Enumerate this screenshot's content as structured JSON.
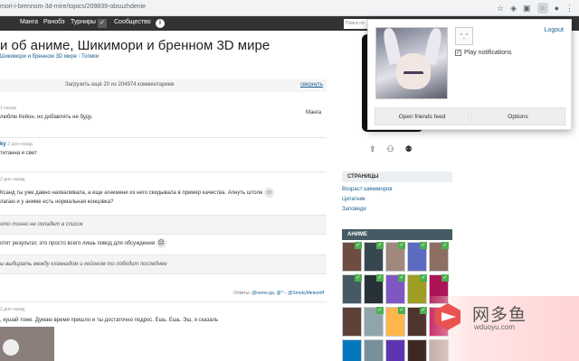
{
  "browser": {
    "url": "mori-i-brennom-3d-mire/topics/209839-obsuzhdenie",
    "icons": [
      "star-icon",
      "shield-icon",
      "extension-icon",
      "extension-active-icon",
      "profile-icon",
      "menu-icon"
    ]
  },
  "nav": {
    "items": [
      "Манга",
      "Ранобэ",
      "Турниры",
      "Сообщество"
    ],
    "search_placeholder": "Поиск по"
  },
  "page": {
    "title": "и об аниме, Шикимори и бренном 3D мире",
    "breadcrumbs": [
      "Шикимори и бренном 3D мире",
      "Топики"
    ]
  },
  "comments": {
    "load_more": "Загрузить ещё 20 из 204974 комментариев",
    "collapse": "свернуть",
    "items": [
      {
        "meta": "1 назад",
        "text": "люблю Кейон, но добавлять не буду."
      },
      {
        "nick": "ky",
        "meta": "2 дня назад",
        "text": "титанна и свет"
      },
      {
        "meta": "2 дня назад",
        "text": "Ксанд ты уже давно нахваливала, а еще агнемени из него скидывала в пример качества. Апнуть штоле",
        "text2": "лагаю и у аниме есть нормальная концовка?"
      },
      {
        "quote": "ото тонно не попадет в список"
      },
      {
        "text": "отит результат, это просто всего лишь повод для обсуждения"
      },
      {
        "quote": "ы выбирать между кланнадом и кейоном то победит последнее"
      },
      {
        "replies_label": "Ответы:",
        "replies": [
          "@nemo.ga",
          "@*~",
          "@SmokyMeteoriff"
        ]
      },
      {
        "meta": "2 дня назад",
        "text": ", кушай тоже. Думаю время пришло и ты достаточно подрос. Ешь. Ешь. Эш, я сказаль"
      }
    ],
    "manga_tag": "Манга"
  },
  "sidebar": {
    "pages_header": "СТРАНИЦЫ",
    "links": [
      "Возраст шикиморов",
      "Цитатник",
      "Заповеди"
    ],
    "anime_header": "АНИМЕ",
    "anime_tiles": [
      {
        "color": "#6d4c41",
        "checked": true
      },
      {
        "color": "#37474f",
        "checked": true
      },
      {
        "color": "#a1887f",
        "checked": true
      },
      {
        "color": "#5c6bc0",
        "checked": true
      },
      {
        "color": "#8d6e63",
        "checked": true
      },
      {
        "color": "#455a64",
        "checked": true
      },
      {
        "color": "#263238",
        "checked": true
      },
      {
        "color": "#7e57c2",
        "checked": true
      },
      {
        "color": "#9e9d24",
        "checked": true
      },
      {
        "color": "#ad1457",
        "checked": true
      },
      {
        "color": "#5d4037",
        "checked": false
      },
      {
        "color": "#90a4ae",
        "checked": true
      },
      {
        "color": "#ffb74d",
        "checked": true
      },
      {
        "color": "#4e342e",
        "checked": true
      },
      {
        "color": "#c2185b",
        "checked": true
      },
      {
        "color": "#0277bd",
        "checked": false
      },
      {
        "color": "#78909c",
        "checked": false
      },
      {
        "color": "#5e35b1",
        "checked": false
      },
      {
        "color": "#3e2723",
        "checked": false
      },
      {
        "color": "#bcaaa4",
        "checked": false
      }
    ]
  },
  "popup": {
    "logout": "Logout",
    "play_notifications": "Play notifications",
    "open_feed": "Open friends feed",
    "options": "Options",
    "mini_avatar": "^_^"
  },
  "watermark": {
    "cn": "网多鱼",
    "en": "wduoyu.com"
  }
}
